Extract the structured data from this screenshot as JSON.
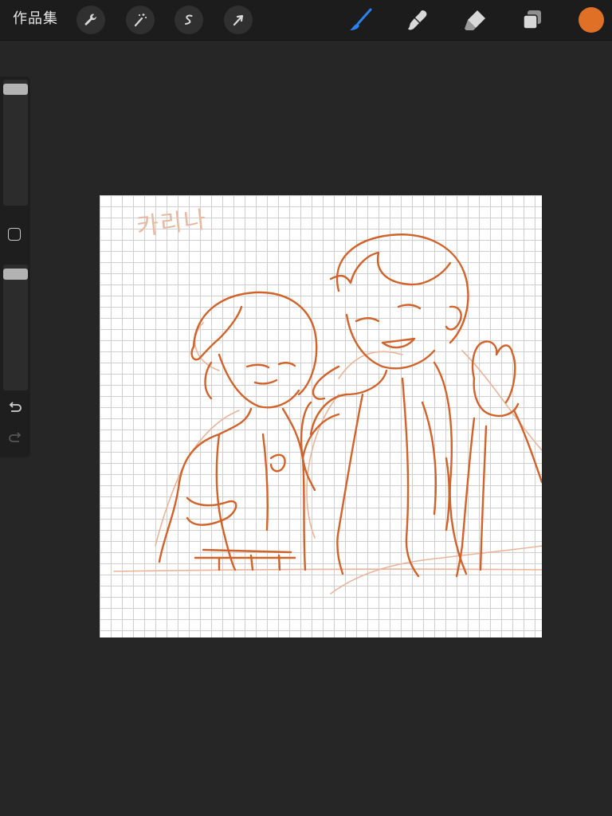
{
  "toolbar": {
    "gallery_label": "作品集",
    "left_tools": [
      "wrench-icon",
      "magic-wand-icon",
      "selection-icon",
      "transform-arrow-icon"
    ],
    "right_tools": [
      "brush-icon",
      "smudge-icon",
      "eraser-icon",
      "layers-icon"
    ],
    "active_tool": "brush-icon",
    "current_color": "#e07025"
  },
  "sidebar": {
    "brush_size_level": 0.97,
    "opacity_level": 0.97,
    "icons": [
      "modify-button",
      "undo-icon",
      "redo-icon"
    ]
  },
  "canvas": {
    "signature_text": "카리나",
    "sketch_color": "#d0622a",
    "light_sketch_color": "#e9b49a"
  }
}
